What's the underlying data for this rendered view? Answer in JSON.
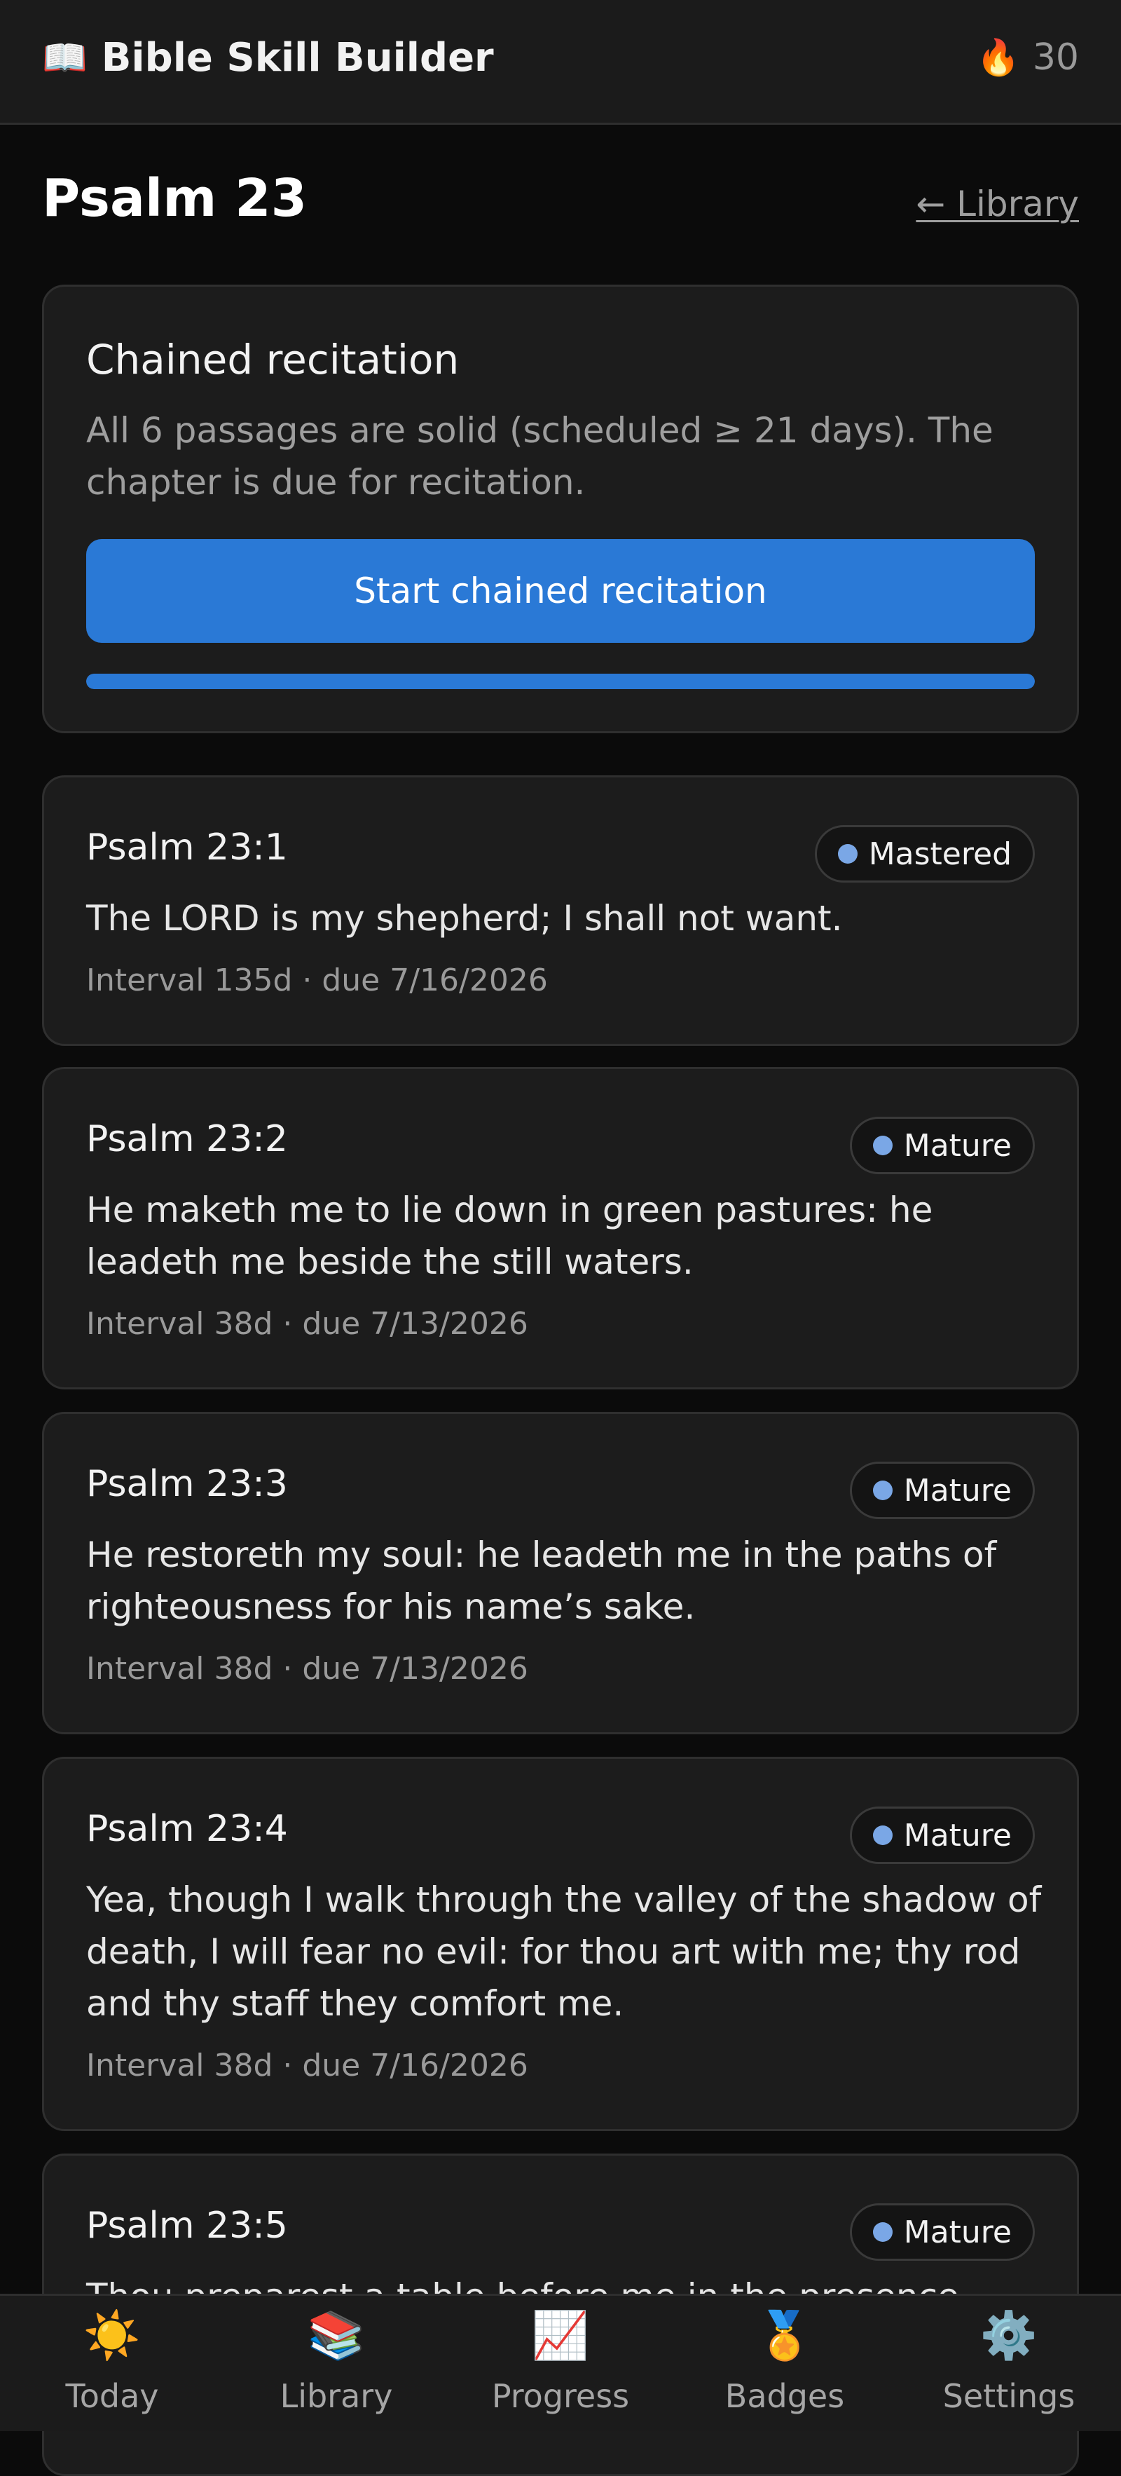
{
  "app": {
    "title": "Bible Skill Builder",
    "title_icon": "📖",
    "streak_icon": "🔥",
    "streak_count": "30"
  },
  "page": {
    "title": "Psalm 23",
    "back_link": "← Library"
  },
  "recitation": {
    "title": "Chained recitation",
    "description": "All 6 passages are solid (scheduled ≥ 21 days). The chapter is due for recitation.",
    "button_label": "Start chained recitation",
    "progress_percent": 100
  },
  "passages": [
    {
      "ref": "Psalm 23:1",
      "status": "Mastered",
      "text": "The LORD is my shepherd; I shall not want.",
      "meta": "Interval 135d · due 7/16/2026"
    },
    {
      "ref": "Psalm 23:2",
      "status": "Mature",
      "text": "He maketh me to lie down in green pastures: he leadeth me beside the still waters.",
      "meta": "Interval 38d · due 7/13/2026"
    },
    {
      "ref": "Psalm 23:3",
      "status": "Mature",
      "text": "He restoreth my soul: he leadeth me in the paths of righteousness for his name’s sake.",
      "meta": "Interval 38d · due 7/13/2026"
    },
    {
      "ref": "Psalm 23:4",
      "status": "Mature",
      "text": "Yea, though I walk through the valley of the shadow of death, I will fear no evil: for thou art with me; thy rod and thy staff they comfort me.",
      "meta": "Interval 38d · due 7/16/2026"
    },
    {
      "ref": "Psalm 23:5",
      "status": "Mature",
      "text": "Thou preparest a table before me in the presence",
      "meta": ""
    }
  ],
  "nav": [
    {
      "label": "Today",
      "icon": "☀️"
    },
    {
      "label": "Library",
      "icon": "📚"
    },
    {
      "label": "Progress",
      "icon": "📈"
    },
    {
      "label": "Badges",
      "icon": "🏅"
    },
    {
      "label": "Settings",
      "icon": "⚙️"
    }
  ],
  "colors": {
    "accent": "#2a79d6",
    "status_dot": "#7aa7e6",
    "background": "#0b0b0b",
    "card": "#1c1c1c"
  }
}
